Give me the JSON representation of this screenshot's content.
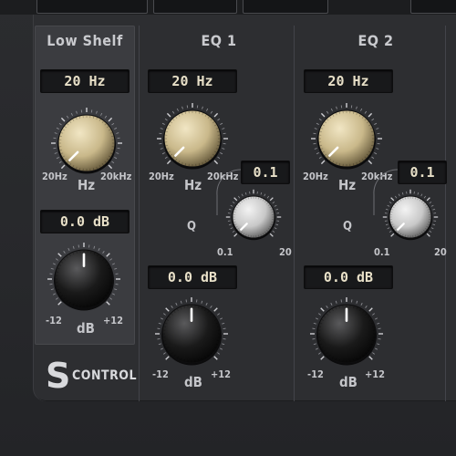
{
  "brand": {
    "mark": "S",
    "text": "CONTROL"
  },
  "low_shelf": {
    "title": "Low Shelf",
    "freq_readout": "20 Hz",
    "freq_min": "20Hz",
    "freq_max": "20kHz",
    "freq_unit": "Hz",
    "gain_readout": "0.0 dB",
    "gain_min": "-12",
    "gain_max": "+12",
    "gain_unit": "dB"
  },
  "eq1": {
    "title": "EQ 1",
    "freq_readout": "20 Hz",
    "freq_min": "20Hz",
    "freq_max": "20kHz",
    "freq_unit": "Hz",
    "q_readout": "0.1",
    "q_label": "Q",
    "q_min": "0.1",
    "q_max": "20",
    "gain_readout": "0.0 dB",
    "gain_min": "-12",
    "gain_max": "+12",
    "gain_unit": "dB"
  },
  "eq2": {
    "title": "EQ 2",
    "freq_readout": "20 Hz",
    "freq_min": "20Hz",
    "freq_max": "20kHz",
    "freq_unit": "Hz",
    "q_readout": "0.1",
    "q_label": "Q",
    "q_min": "0.1",
    "q_max": "20",
    "gain_readout": "0.0 dB",
    "gain_min": "-12",
    "gain_max": "+12",
    "gain_unit": "dB"
  },
  "knob_levels": {
    "freq": 0.0,
    "q": 0.0,
    "gain": 0.5
  },
  "colors": {
    "gold_knob": "#c9b88a",
    "silver_knob": "#c8c8c8",
    "black_knob": "#1a1a1a",
    "panel": "#2d2e31",
    "readout_text": "#e8e0c8"
  }
}
